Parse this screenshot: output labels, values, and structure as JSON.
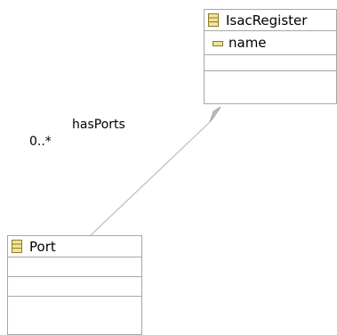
{
  "diagram": {
    "classes": [
      {
        "name": "IsacRegister",
        "icon": "class-icon",
        "attributes": [
          {
            "name": "name",
            "icon": "attribute-icon"
          }
        ]
      },
      {
        "name": "Port",
        "icon": "class-icon",
        "attributes": []
      }
    ],
    "association": {
      "type": "composition",
      "name": "hasPorts",
      "multiplicity": "0..*",
      "source": "IsacRegister",
      "target": "Port"
    }
  },
  "colors": {
    "border": "#a7a7a7",
    "connector": "#c8c8c8",
    "icon_fill": "#f0e39a",
    "icon_stroke": "#8e7b25"
  }
}
